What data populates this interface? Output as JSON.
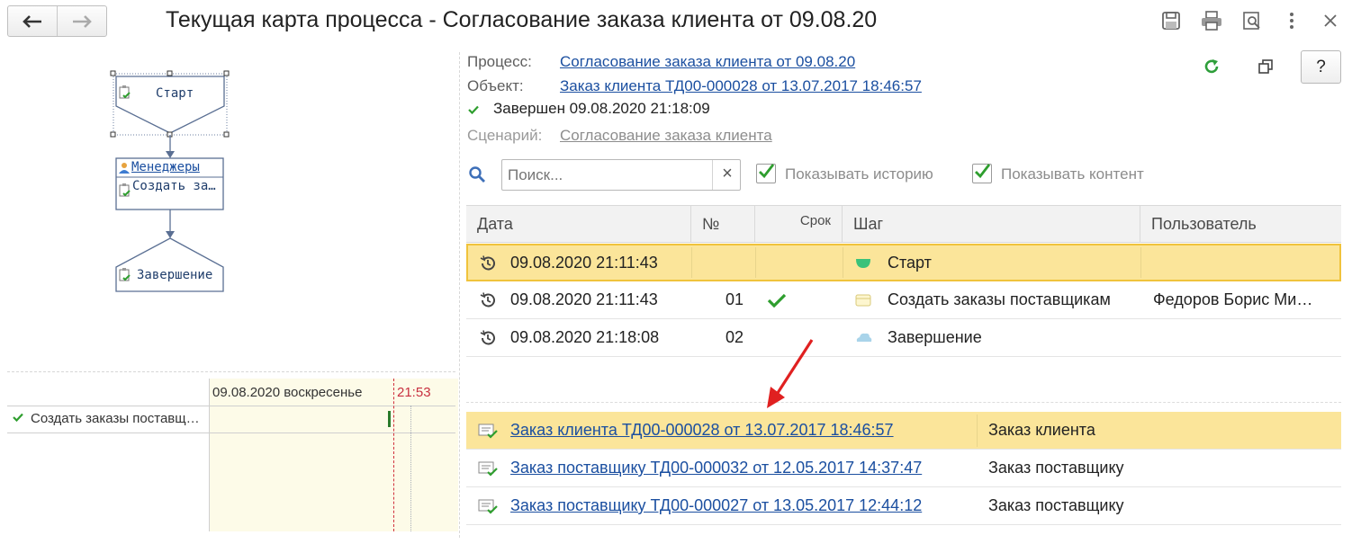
{
  "window": {
    "title": "Текущая карта процесса - Согласование заказа клиента от 09.08.20",
    "help_label": "?"
  },
  "map": {
    "start_label": "Старт",
    "task_role": "Менеджеры",
    "task_label": "Создать за…",
    "end_label": "Завершение"
  },
  "gantt": {
    "date_header": "09.08.2020 воскресенье",
    "time_marker": "21:53",
    "task_label": "Создать заказы поставщ…"
  },
  "info": {
    "process_label": "Процесс:",
    "process_value": "Согласование заказа клиента от 09.08.20",
    "object_label": "Объект:",
    "object_value": "Заказ клиента ТД00-000028 от 13.07.2017 18:46:57",
    "status_text": "Завершен 09.08.2020 21:18:09",
    "scenario_label": "Сценарий:",
    "scenario_value": "Согласование заказа клиента"
  },
  "search": {
    "placeholder": "Поиск...",
    "clear_label": "×"
  },
  "options": {
    "show_history": "Показывать историю",
    "show_content": "Показывать контент"
  },
  "steps_table": {
    "columns": [
      "Дата",
      "№",
      "Срок",
      "Шаг",
      "Пользователь"
    ],
    "rows": [
      {
        "date": "09.08.2020 21:11:43",
        "num": "",
        "deadline_ok": false,
        "step": "Старт",
        "user": ""
      },
      {
        "date": "09.08.2020 21:11:43",
        "num": "01",
        "deadline_ok": true,
        "step": "Создать заказы поставщикам",
        "user": "Федоров Борис Ми…"
      },
      {
        "date": "09.08.2020 21:18:08",
        "num": "02",
        "deadline_ok": false,
        "step": "Завершение",
        "user": ""
      }
    ]
  },
  "documents": {
    "rows": [
      {
        "link": "Заказ клиента ТД00-000028 от 13.07.2017 18:46:57",
        "type": "Заказ клиента"
      },
      {
        "link": "Заказ поставщику ТД00-000032 от 12.05.2017 14:37:47",
        "type": "Заказ поставщику"
      },
      {
        "link": "Заказ поставщику ТД00-000027 от 13.05.2017 12:44:12",
        "type": "Заказ поставщику"
      }
    ]
  },
  "colors": {
    "selection": "#fbe59a",
    "selection_border": "#f0c33c",
    "link": "#1b4fa0",
    "check_green": "#2e9e2e",
    "annotation_arrow": "#e02020"
  }
}
